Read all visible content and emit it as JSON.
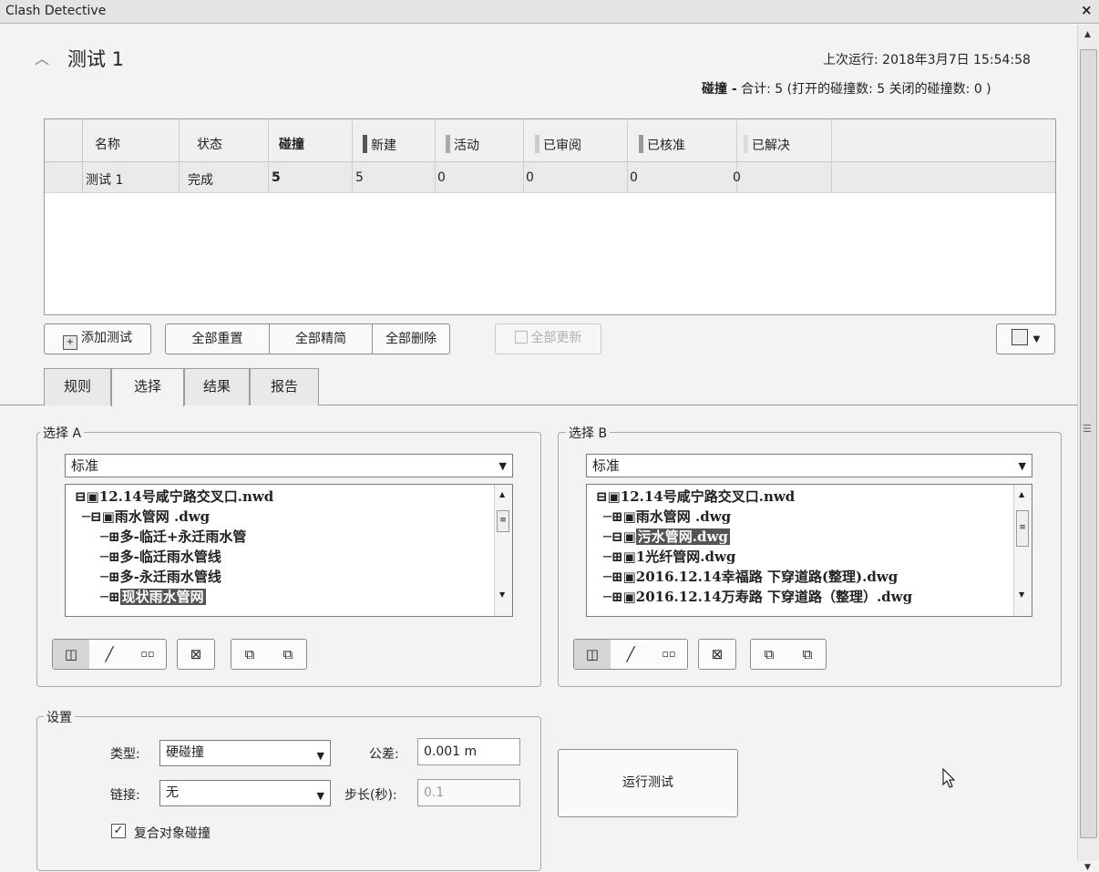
{
  "window": {
    "title": "Clash Detective",
    "close_icon": "×"
  },
  "test": {
    "name": "测试 1",
    "last_run": "上次运行: 2018年3月7日 15:54:58",
    "summary_prefix": "碰撞 -",
    "summary_detail": " 合计: 5 (打开的碰撞数: 5 关闭的碰撞数: 0 )"
  },
  "table": {
    "headers": [
      "名称",
      "状态",
      "碰撞",
      "新建",
      "活动",
      "已审阅",
      "已核准",
      "已解决"
    ],
    "status_colors": {
      "新建": "#555555",
      "活动": "#aaaaaa",
      "已审阅": "#cccccc",
      "已核准": "#999999",
      "已解决": "#dddddd"
    },
    "rows": [
      [
        "测试 1",
        "完成",
        "5",
        "5",
        "0",
        "0",
        "0",
        "0"
      ]
    ]
  },
  "toolbar": {
    "add_test": "添加测试",
    "reset_all": "全部重置",
    "compact_all": "全部精简",
    "delete_all": "全部删除",
    "update_all": "全部更新"
  },
  "tabs": [
    "规则",
    "选择",
    "结果",
    "报告"
  ],
  "selection_a": {
    "legend": "选择 A",
    "mode": "标准",
    "tree": [
      {
        "label": "12.14号咸宁路交叉口.nwd",
        "selected": false
      },
      {
        "label": "雨水管网 .dwg",
        "selected": false
      },
      {
        "label": "多-临迁+永迁雨水管",
        "selected": false
      },
      {
        "label": "多-临迁雨水管线",
        "selected": false
      },
      {
        "label": "多-永迁雨水管线",
        "selected": false
      },
      {
        "label": "现状雨水管网",
        "selected": true
      }
    ]
  },
  "selection_b": {
    "legend": "选择 B",
    "mode": "标准",
    "tree": [
      {
        "label": "12.14号咸宁路交叉口.nwd",
        "selected": false
      },
      {
        "label": "雨水管网 .dwg",
        "selected": false
      },
      {
        "label": "污水管网.dwg",
        "selected": true
      },
      {
        "label": "1光纤管网.dwg",
        "selected": false
      },
      {
        "label": "2016.12.14幸福路 下穿道路(整理).dwg",
        "selected": false
      },
      {
        "label": "2016.12.14万寿路 下穿道路（整理）.dwg",
        "selected": false
      }
    ]
  },
  "settings": {
    "legend": "设置",
    "type_label": "类型:",
    "type_value": "硬碰撞",
    "tolerance_label": "公差:",
    "tolerance_value": "0.001 m",
    "link_label": "链接:",
    "link_value": "无",
    "step_label": "步长(秒):",
    "step_value": "0.1",
    "composite_label": "复合对象碰撞",
    "composite_checked": true
  },
  "run_button": "运行测试"
}
